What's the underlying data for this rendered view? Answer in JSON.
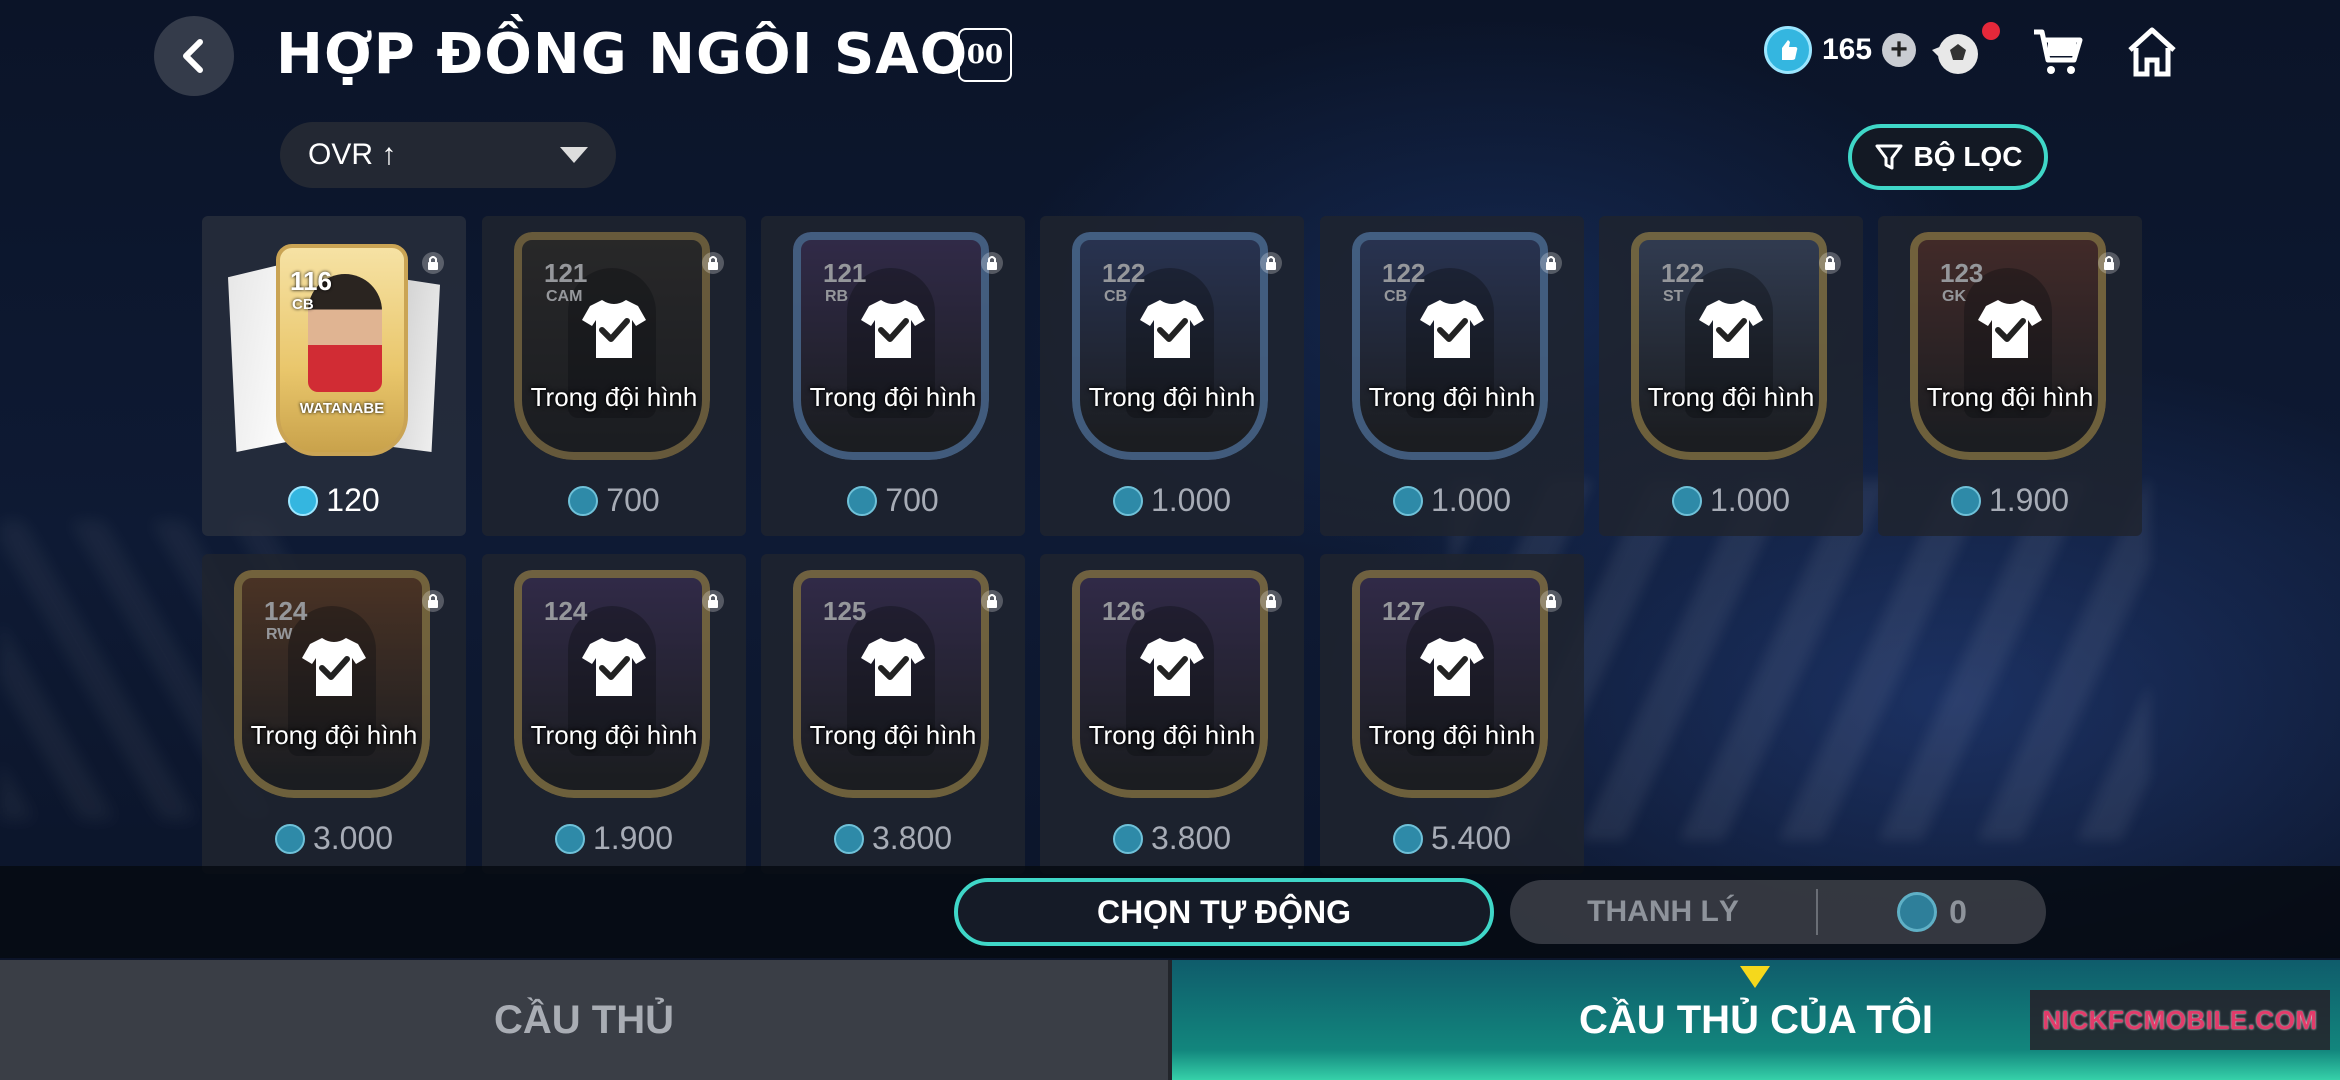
{
  "header": {
    "title": "HỢP ĐỒNG NGÔI SAO",
    "title_badge": "00",
    "currency_count": "165"
  },
  "icons": {
    "back": "chevron-left-icon",
    "currency": "coin-icon",
    "add": "plus-icon",
    "ball": "football-icon",
    "cart": "cart-icon",
    "home": "home-icon",
    "filter": "funnel-icon",
    "lock": "lock-icon",
    "jersey": "jersey-check-icon"
  },
  "sort": {
    "label": "OVR ↑"
  },
  "filter": {
    "label": "BỘ LỌC"
  },
  "featured": {
    "ovr": "116",
    "position": "CB",
    "name": "WATANABE",
    "price": "120"
  },
  "tiles": [
    {
      "ovr": "121",
      "position": "CAM",
      "status": "Trong đội hình",
      "price": "700",
      "frame": "#b89a55",
      "bg": "#3a3630"
    },
    {
      "ovr": "121",
      "position": "RB",
      "status": "Trong đội hình",
      "price": "700",
      "frame": "#6fa0d8",
      "bg": "#4a3a6a"
    },
    {
      "ovr": "122",
      "position": "CB",
      "status": "Trong đội hình",
      "price": "1.000",
      "frame": "#6fa0d8",
      "bg": "#3a4a7a"
    },
    {
      "ovr": "122",
      "position": "CB",
      "status": "Trong đội hình",
      "price": "1.000",
      "frame": "#6fa0d8",
      "bg": "#3a4a7a"
    },
    {
      "ovr": "122",
      "position": "ST",
      "status": "Trong đội hình",
      "price": "1.000",
      "frame": "#c8a858",
      "bg": "#4a5a7a"
    },
    {
      "ovr": "123",
      "position": "GK",
      "status": "Trong đội hình",
      "price": "1.900",
      "frame": "#c8a858",
      "bg": "#6a3a30"
    },
    {
      "ovr": "124",
      "position": "RW",
      "status": "Trong đội hình",
      "price": "3.000",
      "frame": "#c8a858",
      "bg": "#7a4a28"
    },
    {
      "ovr": "124",
      "position": "",
      "status": "Trong đội hình",
      "price": "1.900",
      "frame": "#c8a858",
      "bg": "#4a3a6a"
    },
    {
      "ovr": "125",
      "position": "",
      "status": "Trong đội hình",
      "price": "3.800",
      "frame": "#c8a858",
      "bg": "#4a3a6a"
    },
    {
      "ovr": "126",
      "position": "",
      "status": "Trong đội hình",
      "price": "3.800",
      "frame": "#c8a858",
      "bg": "#4a3a6a"
    },
    {
      "ovr": "127",
      "position": "",
      "status": "Trong đội hình",
      "price": "5.400",
      "frame": "#c8a858",
      "bg": "#4a3a6a"
    }
  ],
  "actions": {
    "auto_select": "CHỌN TỰ ĐỘNG",
    "sell": "THANH LÝ",
    "sell_total": "0"
  },
  "tabs": {
    "players": "CẦU THỦ",
    "my_players": "CẦU THỦ CỦA TÔI"
  },
  "watermark": "NICKFCMOBILE.COM",
  "colors": {
    "accent": "#3fd7c8",
    "coin": "#34b6e0",
    "notification": "#e5283a",
    "tab_indicator": "#f5d81c"
  }
}
